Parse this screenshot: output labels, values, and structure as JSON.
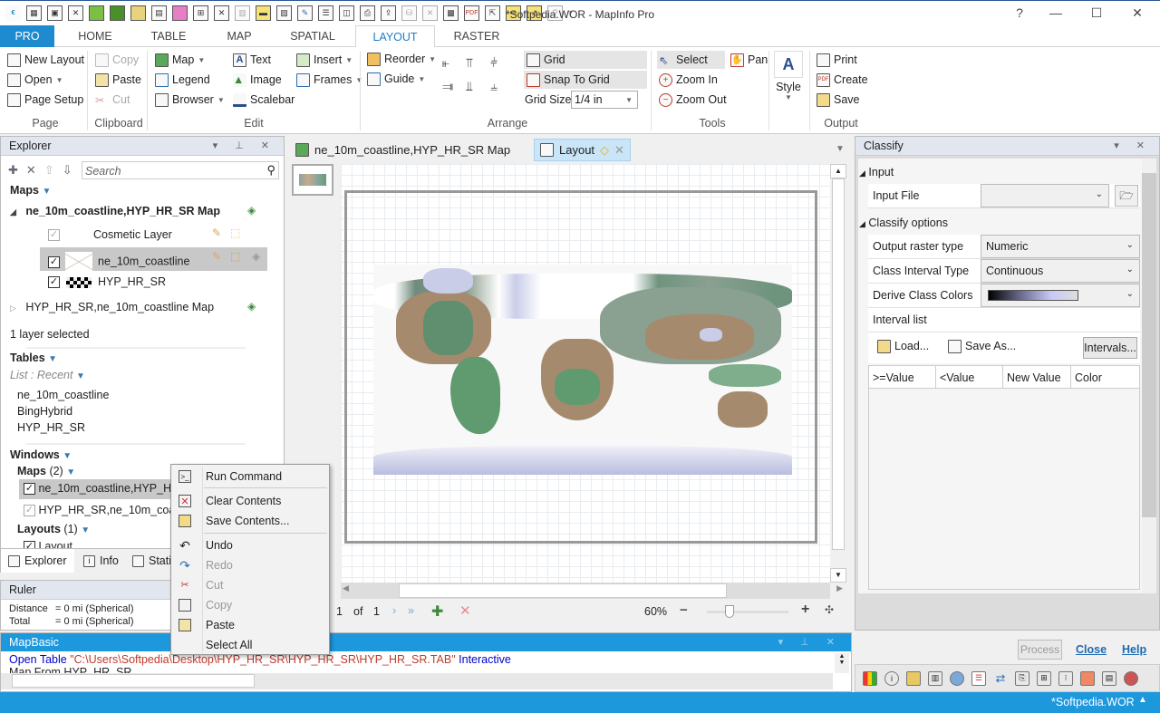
{
  "window": {
    "title": "*Softpedia.WOR - MapInfo Pro",
    "controls": [
      "?",
      "—",
      "☐",
      "✕"
    ]
  },
  "quick_access": [
    "app-logo",
    "new-table",
    "save-table",
    "close-table",
    "open-map",
    "open-raster",
    "open-grid",
    "new-doc",
    "open-image",
    "new-browser",
    "close-browser",
    "copy-table",
    "save-file",
    "save-copy",
    "edit",
    "workspace",
    "layout",
    "print",
    "export",
    "db",
    "db-close",
    "export-img",
    "pdf",
    "open",
    "import",
    "export-ws",
    "zoom",
    "more"
  ],
  "ribbon_tabs": [
    {
      "label": "PRO"
    },
    {
      "label": "HOME"
    },
    {
      "label": "TABLE"
    },
    {
      "label": "MAP"
    },
    {
      "label": "SPATIAL"
    },
    {
      "label": "LAYOUT"
    },
    {
      "label": "RASTER"
    }
  ],
  "ribbon": {
    "page": {
      "new_layout": "New Layout",
      "open": "Open",
      "page_setup": "Page Setup",
      "group": "Page"
    },
    "clipboard": {
      "copy": "Copy",
      "paste": "Paste",
      "cut": "Cut",
      "group": "Clipboard"
    },
    "edit": {
      "map": "Map",
      "legend": "Legend",
      "browser": "Browser",
      "text": "Text",
      "image": "Image",
      "scalebar": "Scalebar",
      "insert": "Insert",
      "frames": "Frames",
      "group": "Edit"
    },
    "arrange": {
      "reorder": "Reorder",
      "guide": "Guide",
      "grid": "Grid",
      "snap_to_grid": "Snap To Grid",
      "grid_size_label": "Grid Size",
      "grid_size_value": "1/4 in",
      "group": "Arrange"
    },
    "tools": {
      "select": "Select",
      "pan": "Pan",
      "zoom_in": "Zoom In",
      "zoom_out": "Zoom Out",
      "group": "Tools"
    },
    "style": {
      "label": "Style"
    },
    "output": {
      "print": "Print",
      "create": "Create",
      "save": "Save",
      "group": "Output"
    }
  },
  "explorer": {
    "title": "Explorer",
    "search_placeholder": "Search",
    "maps_header": "Maps",
    "map1": {
      "name": "ne_10m_coastline,HYP_HR_SR Map",
      "layers": [
        {
          "name": "Cosmetic Layer",
          "checked": true
        },
        {
          "name": "ne_10m_coastline",
          "checked": true,
          "selected": true
        },
        {
          "name": "HYP_HR_SR",
          "checked": true
        }
      ]
    },
    "map2": {
      "name": "HYP_HR_SR,ne_10m_coastline Map"
    },
    "selection_status": "1 layer selected",
    "tables_header": "Tables",
    "list_label": "List : Recent",
    "tables": [
      "ne_10m_coastline",
      "BingHybrid",
      "HYP_HR_SR"
    ],
    "windows_header": "Windows",
    "maps_sub": "Maps",
    "maps_count": "(2)",
    "windows_maps": [
      "ne_10m_coastline,HYP_HR_SR Map",
      "HYP_HR_SR,ne_10m_coastline Map"
    ],
    "layouts_sub": "Layouts",
    "layouts_count": "(1)",
    "windows_layouts": [
      "Layout"
    ]
  },
  "bottom_tabs": [
    {
      "label": "Explorer"
    },
    {
      "label": "Info"
    },
    {
      "label": "Statistics"
    }
  ],
  "ruler": {
    "title": "Ruler",
    "distance_label": "Distance",
    "distance_value": "= 0 mi (Spherical)",
    "total_label": "Total",
    "total_value": "= 0 mi (Spherical)"
  },
  "doc_tabs": [
    {
      "label": "ne_10m_coastline,HYP_HR_SR Map"
    },
    {
      "label": "Layout"
    }
  ],
  "layout_nav": {
    "page": "1",
    "of": "of",
    "total": "1",
    "zoom": "60%",
    "zoom_slider_fraction": 0.25
  },
  "classify": {
    "title": "Classify",
    "input_section": "Input",
    "input_file_label": "Input File",
    "input_file_value": "",
    "options_section": "Classify options",
    "output_raster_type_label": "Output raster type",
    "output_raster_type_value": "Numeric",
    "class_interval_type_label": "Class Interval Type",
    "class_interval_type_value": "Continuous",
    "derive_class_colors_label": "Derive Class Colors",
    "interval_list_label": "Interval list",
    "load_label": "Load...",
    "save_as_label": "Save As...",
    "intervals_label": "Intervals...",
    "columns": [
      ">=Value",
      "<Value",
      "New Value",
      "Color"
    ],
    "process_label": "Process",
    "close_label": "Close",
    "help_label": "Help"
  },
  "mapbasic": {
    "title": "MapBasic",
    "line1_keyword": "Open Table",
    "line1_string": "\"C:\\Users\\Softpedia\\Desktop\\HYP_HR_SR\\HYP_HR_SR\\HYP_HR_SR.TAB\"",
    "line1_tail": "Interactive",
    "line2": "Map From HYP_HR_SR"
  },
  "context_menu": [
    {
      "label": "Run Command",
      "icon": "terminal-icon",
      "enabled": true
    },
    {
      "label": "Clear Contents",
      "icon": "clear-icon",
      "enabled": true
    },
    {
      "label": "Save Contents...",
      "icon": "save-icon",
      "enabled": true
    },
    {
      "label": "Undo",
      "icon": "undo-icon",
      "enabled": true
    },
    {
      "label": "Redo",
      "icon": "redo-icon",
      "enabled": false
    },
    {
      "label": "Cut",
      "icon": "scissors-icon",
      "enabled": false
    },
    {
      "label": "Copy",
      "icon": "copy-icon",
      "enabled": false
    },
    {
      "label": "Paste",
      "icon": "paste-icon",
      "enabled": true
    },
    {
      "label": "Select All",
      "icon": "",
      "enabled": true
    }
  ],
  "status": {
    "workspace": "*Softpedia.WOR"
  },
  "colors": {
    "accent": "#1e98dc",
    "pro_tab": "#1e8bd1",
    "active_tab_text": "#1e7ac6",
    "string_red": "#c0392b",
    "keyword_blue": "#0000cc"
  }
}
